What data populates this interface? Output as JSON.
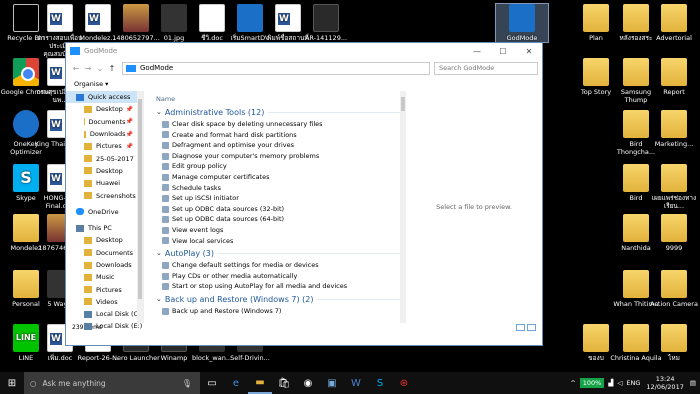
{
  "desktop": {
    "icons": [
      {
        "label": "Recycle Bin"
      },
      {
        "label": "ตารางสอบเพื่อนประเมินคุณสมบัติ..."
      },
      {
        "label": "Mondelez..."
      },
      {
        "label": "1480652797..."
      },
      {
        "label": "01.jpg"
      },
      {
        "label": "ชีวิ.doc"
      },
      {
        "label": "เริ่มSmartDV"
      },
      {
        "label": "พิมพ์ชื่อสถานที่ประชุม"
      },
      {
        "label": "AR-141129..."
      },
      {
        "label": "GodMode"
      },
      {
        "label": "Plan"
      },
      {
        "label": "หลังรองสระ"
      },
      {
        "label": "Advertorial"
      },
      {
        "label": "Google Chrome"
      },
      {
        "label": "กรมสุขเปลี่ยนชื่อนพ..."
      },
      {
        "label": "Top Story"
      },
      {
        "label": "Samsung Thump"
      },
      {
        "label": "Report"
      },
      {
        "label": "OneKey Optimizer"
      },
      {
        "label": "King Thailand..."
      },
      {
        "label": "Bird Thongcha..."
      },
      {
        "label": "Marketing..."
      },
      {
        "label": "Skype"
      },
      {
        "label": "HONG-K... Final.doc"
      },
      {
        "label": "Bird"
      },
      {
        "label": "เผยแพร่ช่องทางเรียน..."
      },
      {
        "label": "Mondelez"
      },
      {
        "label": "187674691..."
      },
      {
        "label": "Nanthida"
      },
      {
        "label": "9999"
      },
      {
        "label": "Personal"
      },
      {
        "label": "5 Way..."
      },
      {
        "label": "Whan Thitima"
      },
      {
        "label": "Action Camera"
      },
      {
        "label": "LINE"
      },
      {
        "label": "เพิ่ม.doc"
      },
      {
        "label": "Report-26-..."
      },
      {
        "label": "Nero Launcher"
      },
      {
        "label": "Winamp"
      },
      {
        "label": "block_wan..."
      },
      {
        "label": "Self-Drivin..."
      },
      {
        "label": "ของบ"
      },
      {
        "label": "Christina Aquila"
      },
      {
        "label": "ไหม"
      }
    ]
  },
  "window": {
    "title": "GodMode",
    "controls": {
      "minimize": "—",
      "maximize": "☐",
      "close": "✕"
    },
    "nav": {
      "back": "←",
      "forward": "→",
      "dropdown": "⌄",
      "up": "↑"
    },
    "address": "GodMode",
    "search_placeholder": "Search GodMode",
    "toolbar_organise": "Organise ▾",
    "column_header": "Name",
    "preview_text": "Select a file to preview.",
    "status": "239 items",
    "sidebar": [
      {
        "label": "Quick access",
        "level": 0,
        "icon": "star",
        "selected": true
      },
      {
        "label": "Desktop",
        "level": 1,
        "icon": "folder",
        "pinned": true
      },
      {
        "label": "Documents",
        "level": 1,
        "icon": "folder",
        "pinned": true
      },
      {
        "label": "Downloads",
        "level": 1,
        "icon": "folder",
        "pinned": true
      },
      {
        "label": "Pictures",
        "level": 1,
        "icon": "folder",
        "pinned": true
      },
      {
        "label": "25-05-2017",
        "level": 1,
        "icon": "folder"
      },
      {
        "label": "Desktop",
        "level": 1,
        "icon": "folder"
      },
      {
        "label": "Huawei",
        "level": 1,
        "icon": "folder"
      },
      {
        "label": "Screenshots",
        "level": 1,
        "icon": "folder"
      },
      {
        "label": "OneDrive",
        "level": 0,
        "icon": "onedrive"
      },
      {
        "label": "This PC",
        "level": 0,
        "icon": "pc"
      },
      {
        "label": "Desktop",
        "level": 1,
        "icon": "folder"
      },
      {
        "label": "Documents",
        "level": 1,
        "icon": "folder"
      },
      {
        "label": "Downloads",
        "level": 1,
        "icon": "folder"
      },
      {
        "label": "Music",
        "level": 1,
        "icon": "folder"
      },
      {
        "label": "Pictures",
        "level": 1,
        "icon": "folder"
      },
      {
        "label": "Videos",
        "level": 1,
        "icon": "folder"
      },
      {
        "label": "Local Disk (C:)",
        "level": 1,
        "icon": "pc"
      },
      {
        "label": "Local Disk (E:)",
        "level": 1,
        "icon": "pc"
      }
    ],
    "groups": [
      {
        "title": "Administrative Tools (12)",
        "items": [
          "Clear disk space by deleting unnecessary files",
          "Create and format hard disk partitions",
          "Defragment and optimise your drives",
          "Diagnose your computer's memory problems",
          "Edit group policy",
          "Manage computer certificates",
          "Schedule tasks",
          "Set up iSCSI initiator",
          "Set up ODBC data sources (32-bit)",
          "Set up ODBC data sources (64-bit)",
          "View event logs",
          "View local services"
        ]
      },
      {
        "title": "AutoPlay (3)",
        "items": [
          "Change default settings for media or devices",
          "Play CDs or other media automatically",
          "Start or stop using AutoPlay for all media and devices"
        ]
      },
      {
        "title": "Back up and Restore (Windows 7) (2)",
        "items": [
          "Back up and Restore (Windows 7)"
        ]
      }
    ]
  },
  "taskbar": {
    "start_icon": "windows-logo",
    "search_placeholder": "Ask me anything",
    "battery": "100%",
    "language": "ENG",
    "time": "13:24",
    "date": "12/06/2017"
  }
}
